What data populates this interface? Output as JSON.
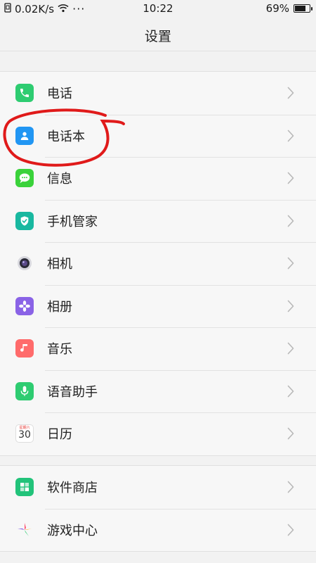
{
  "status_bar": {
    "speed": "0.02K/s",
    "dots": "···",
    "time": "10:22",
    "battery": "69%",
    "battery_level": 0.69
  },
  "header": {
    "title": "设置"
  },
  "section1": {
    "items": [
      {
        "label": "电话",
        "icon": "phone-icon",
        "color": "#2ecc71"
      },
      {
        "label": "电话本",
        "icon": "contacts-icon",
        "color": "#2196f3"
      },
      {
        "label": "信息",
        "icon": "message-icon",
        "color": "#3ad23a"
      },
      {
        "label": "手机管家",
        "icon": "shield-check-icon",
        "color": "#19b8a0"
      },
      {
        "label": "相机",
        "icon": "camera-icon",
        "color": "#e8e8ee"
      },
      {
        "label": "相册",
        "icon": "flower-icon",
        "color": "#8a63e6"
      },
      {
        "label": "音乐",
        "icon": "music-note-icon",
        "color": "#ff6b6b"
      },
      {
        "label": "语音助手",
        "icon": "microphone-icon",
        "color": "#2ecc71"
      },
      {
        "label": "日历",
        "icon": "calendar-icon",
        "color": "#ffffff"
      }
    ]
  },
  "section2": {
    "items": [
      {
        "label": "软件商店",
        "icon": "app-store-icon",
        "color": "#22c37a"
      },
      {
        "label": "游戏中心",
        "icon": "star-game-icon",
        "color": "#ffffff"
      }
    ]
  },
  "calendar_icon": {
    "day": "30",
    "weekday": "星期六"
  },
  "annotation_color": "#e01a1a"
}
